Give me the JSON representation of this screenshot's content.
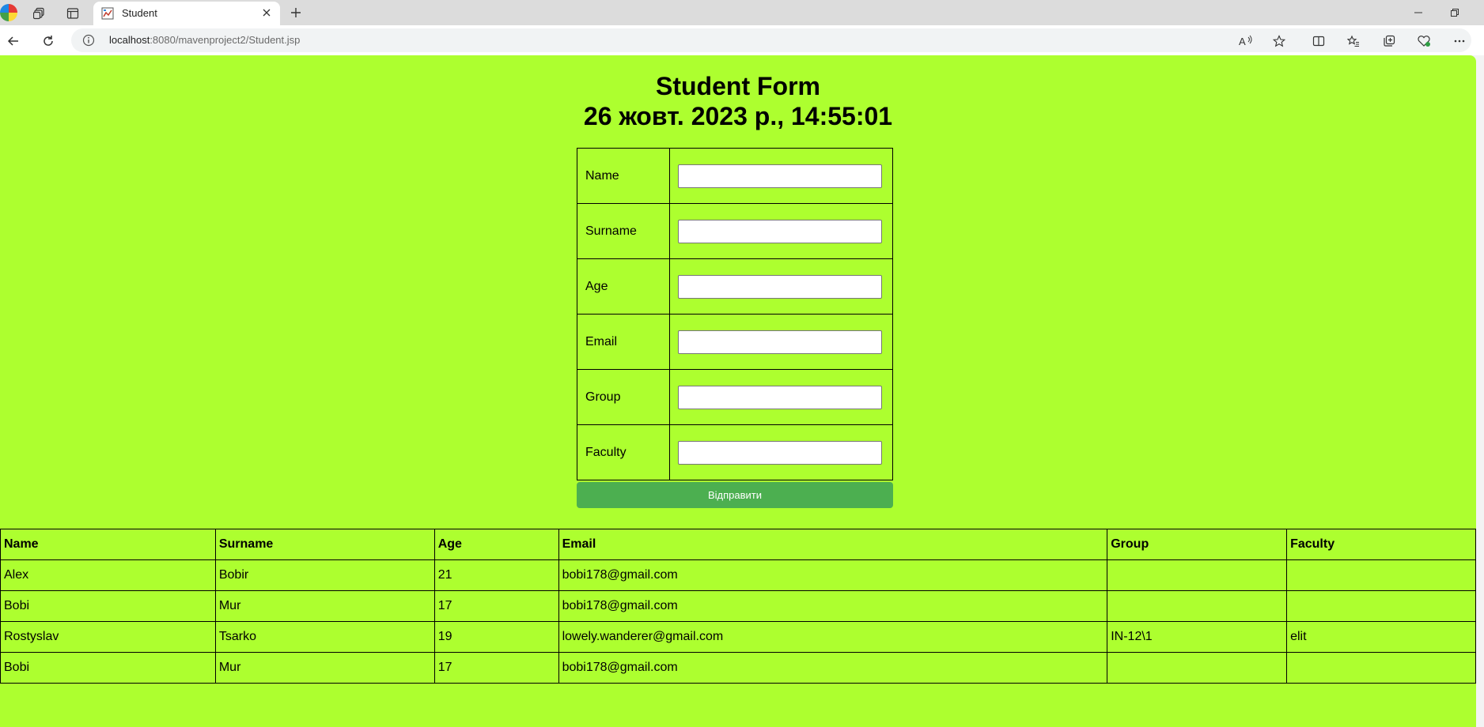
{
  "browser": {
    "tab": {
      "title": "Student"
    },
    "url": {
      "host": "localhost",
      "rest": ":8080/mavenproject2/Student.jsp"
    }
  },
  "page": {
    "title": "Student Form",
    "datetime": "26 жовт. 2023 р., 14:55:01",
    "form": {
      "fields": [
        {
          "label": "Name",
          "value": ""
        },
        {
          "label": "Surname",
          "value": ""
        },
        {
          "label": "Age",
          "value": ""
        },
        {
          "label": "Email",
          "value": ""
        },
        {
          "label": "Group",
          "value": ""
        },
        {
          "label": "Faculty",
          "value": ""
        }
      ],
      "submit_label": "Відправити"
    },
    "table": {
      "headers": [
        "Name",
        "Surname",
        "Age",
        "Email",
        "Group",
        "Faculty"
      ],
      "rows": [
        [
          "Alex",
          "Bobir",
          "21",
          "bobi178@gmail.com",
          "",
          ""
        ],
        [
          "Bobi",
          "Mur",
          "17",
          "bobi178@gmail.com",
          "",
          ""
        ],
        [
          "Rostyslav",
          "Tsarko",
          "19",
          "lowely.wanderer@gmail.com",
          "IN-12\\1",
          "elit"
        ],
        [
          "Bobi",
          "Mur",
          "17",
          "bobi178@gmail.com",
          "",
          ""
        ]
      ]
    }
  },
  "colors": {
    "page_background": "#adff2f",
    "submit_button": "#4caf50"
  },
  "icons": {
    "tab_actions": [
      "workspaces-icon",
      "vertical-tabs-icon"
    ],
    "toolbar": [
      "read-aloud-icon",
      "favorite-star-icon",
      "split-screen-icon",
      "favorites-icon",
      "collections-icon",
      "browser-essentials-icon",
      "more-icon"
    ]
  }
}
